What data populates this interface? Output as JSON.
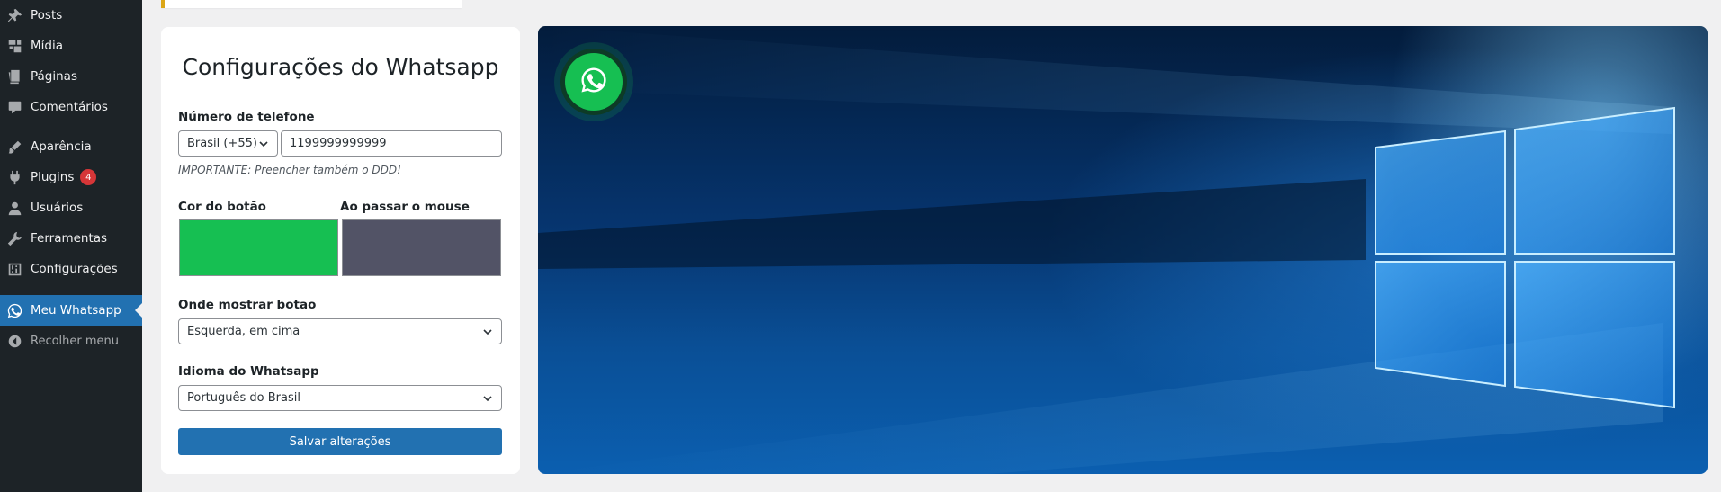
{
  "sidebar": {
    "items": [
      {
        "label": "Posts",
        "icon": "pin-icon"
      },
      {
        "label": "Mídia",
        "icon": "media-icon"
      },
      {
        "label": "Páginas",
        "icon": "pages-icon"
      },
      {
        "label": "Comentários",
        "icon": "comment-icon"
      },
      {
        "label": "Aparência",
        "icon": "brush-icon"
      },
      {
        "label": "Plugins",
        "icon": "plugin-icon",
        "badge": "4"
      },
      {
        "label": "Usuários",
        "icon": "user-icon"
      },
      {
        "label": "Ferramentas",
        "icon": "wrench-icon"
      },
      {
        "label": "Configurações",
        "icon": "settings-icon"
      },
      {
        "label": "Meu Whatsapp",
        "icon": "whatsapp-icon",
        "active": true
      },
      {
        "label": "Recolher menu",
        "icon": "collapse-icon"
      }
    ]
  },
  "settings": {
    "title": "Configurações do Whatsapp",
    "phone_label": "Número de telefone",
    "country_value": "Brasil (+55)",
    "phone_value": "1199999999999",
    "phone_hint": "IMPORTANTE: Preencher também o DDD!",
    "button_color_label": "Cor do botão",
    "hover_color_label": "Ao passar o mouse",
    "button_color": "#16bf52",
    "hover_color": "#525366",
    "position_label": "Onde mostrar botão",
    "position_value": "Esquerda, em cima",
    "language_label": "Idioma do Whatsapp",
    "language_value": "Português do Brasil",
    "save_label": "Salvar alterações"
  },
  "colors": {
    "sidebar_bg": "#1d2327",
    "active_item": "#2271b1",
    "primary_button": "#2271b1",
    "whatsapp_green": "#16bf52",
    "plugin_badge": "#d63638"
  }
}
